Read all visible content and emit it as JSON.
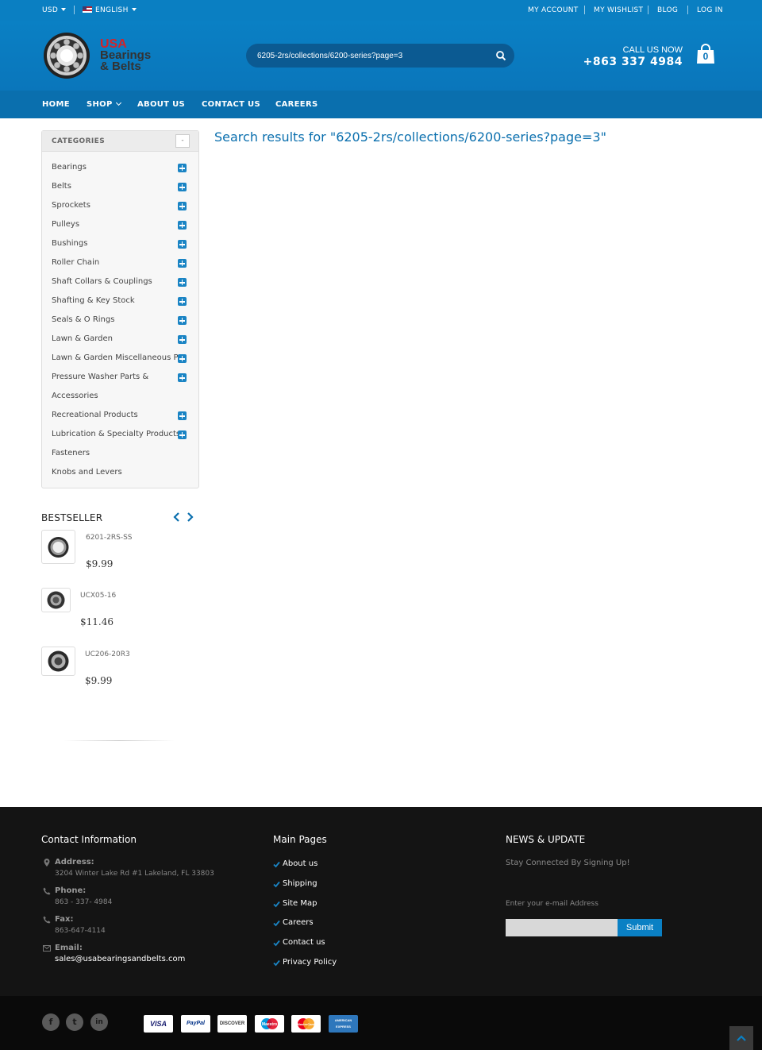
{
  "topbar": {
    "currency": "USD",
    "language": "ENGLISH",
    "links": [
      "MY ACCOUNT",
      "MY WISHLIST",
      "BLOG",
      "LOG IN"
    ]
  },
  "header": {
    "logo_text": "USA Bearings & Belts",
    "search_value": "6205-2rs/collections/6200-series?page=3",
    "call_label": "CALL US NOW",
    "call_number": "+863 337 4984",
    "cart_count": "0"
  },
  "nav": {
    "items": [
      "HOME",
      "SHOP",
      "ABOUT US",
      "CONTACT US",
      "CAREERS"
    ]
  },
  "sidebar": {
    "categories_title": "CATEGORIES",
    "toggle": "-",
    "categories": [
      {
        "label": "Bearings",
        "expandable": true
      },
      {
        "label": "Belts",
        "expandable": true
      },
      {
        "label": "Sprockets",
        "expandable": true
      },
      {
        "label": "Pulleys",
        "expandable": true
      },
      {
        "label": "Bushings",
        "expandable": true
      },
      {
        "label": "Roller Chain",
        "expandable": true
      },
      {
        "label": "Shaft Collars & Couplings",
        "expandable": true
      },
      {
        "label": "Shafting & Key Stock",
        "expandable": true
      },
      {
        "label": "Seals & O Rings",
        "expandable": true
      },
      {
        "label": "Lawn & Garden",
        "expandable": true
      },
      {
        "label": "Lawn & Garden Miscellaneous Pa",
        "expandable": true
      },
      {
        "label": "Pressure Washer Parts &",
        "expandable": true
      },
      {
        "label": "Accessories",
        "expandable": false
      },
      {
        "label": "Recreational Products",
        "expandable": true
      },
      {
        "label": "Lubrication & Specialty Products",
        "expandable": true
      },
      {
        "label": "Fasteners",
        "expandable": false
      },
      {
        "label": "Knobs and Levers",
        "expandable": false
      }
    ],
    "bestseller_title": "BESTSELLER",
    "bestsellers": [
      {
        "name": "6201-2RS-SS",
        "price": "$9.99"
      },
      {
        "name": "UCX05-16",
        "price": "$11.46"
      },
      {
        "name": "UC206-20R3",
        "price": "$9.99"
      }
    ]
  },
  "main": {
    "search_results": "Search results for \"6205-2rs/collections/6200-series?page=3\""
  },
  "footer": {
    "contact_title": "Contact Information",
    "address_label": "Address:",
    "address": "3204 Winter Lake Rd #1 Lakeland, FL 33803",
    "phone_label": "Phone:",
    "phone": "863 - 337- 4984",
    "fax_label": "Fax:",
    "fax": "863-647-4114",
    "email_label": "Email:",
    "email": "sales@usabearingsandbelts.com",
    "pages_title": "Main Pages",
    "pages": [
      "About us",
      "Shipping",
      "Site Map",
      "Careers",
      "Contact us",
      "Privacy Policy"
    ],
    "news_title": "NEWS & UPDATE",
    "news_text": "Stay Connected By Signing Up!",
    "email_prompt": "Enter your e-mail Address",
    "submit": "Submit"
  },
  "bottom": {
    "social": [
      "f",
      "t",
      "in"
    ],
    "payments": [
      "VISA",
      "PayPal",
      "DISCOVER",
      "Maestro",
      "MasterCard",
      "AMERICAN EXPRESS"
    ]
  }
}
